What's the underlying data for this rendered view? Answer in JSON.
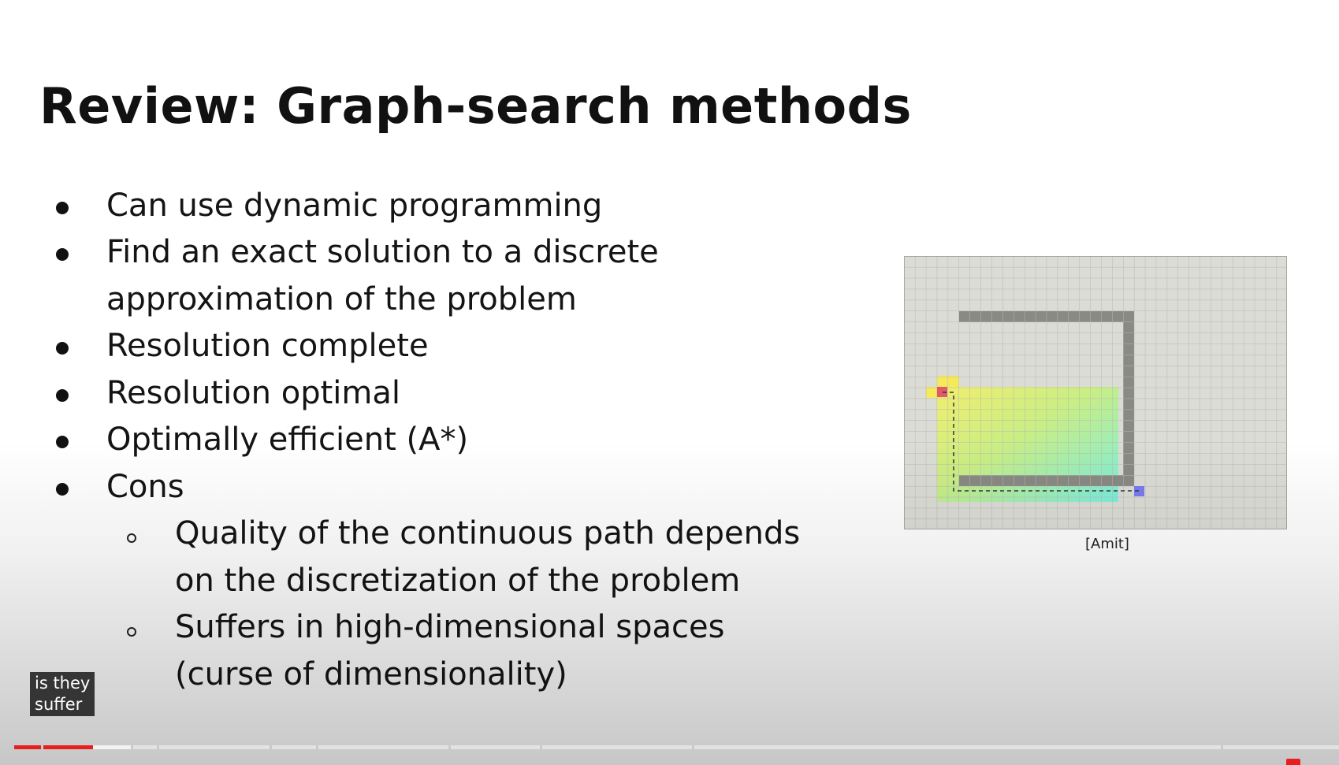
{
  "slide": {
    "title": "Review: Graph-search methods",
    "bullets": [
      {
        "level": 1,
        "lines": [
          "Can use dynamic programming"
        ]
      },
      {
        "level": 1,
        "lines": [
          "Find an exact solution to a discrete",
          "approximation of the problem"
        ]
      },
      {
        "level": 1,
        "lines": [
          "Resolution complete"
        ]
      },
      {
        "level": 1,
        "lines": [
          "Resolution optimal"
        ]
      },
      {
        "level": 1,
        "lines": [
          "Optimally efficient (A*)"
        ]
      },
      {
        "level": 1,
        "lines": [
          "Cons"
        ]
      },
      {
        "level": 2,
        "lines": [
          "Quality of the continuous path depends",
          "on the discretization of the problem"
        ]
      },
      {
        "level": 2,
        "lines": [
          "Suffers in high-dimensional spaces",
          "(curse of dimensionality)"
        ]
      }
    ],
    "figure_caption": "[Amit]"
  },
  "player": {
    "subtitle_lines": [
      "is they",
      "suffer"
    ],
    "progress_played_fraction": 0.055
  },
  "colors": {
    "grid_bg": "#dcdcd6",
    "grid_line": "#b8b8b0",
    "wall": "#8a8a84",
    "start": "#e05a6a",
    "goal": "#7a7cf0",
    "accent": "#e81e1e"
  }
}
